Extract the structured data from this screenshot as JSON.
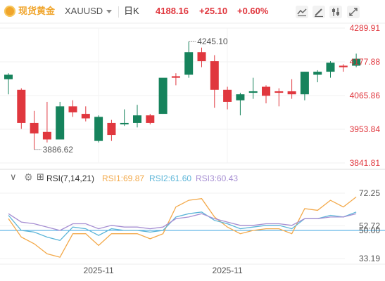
{
  "header": {
    "symbol_name": "现货黄金",
    "symbol_code": "XAUUSD",
    "period": "日K",
    "last_price": "4188.16",
    "change": "+25.10",
    "change_pct": "+0.60%"
  },
  "toolbar": {
    "icons": [
      "line-chart-icon",
      "draw-pen-icon",
      "settings-sliders-icon",
      "fullscreen-icon"
    ]
  },
  "chart_data": [
    {
      "type": "candlestick",
      "title": "",
      "y_ticks": [
        "4289.91",
        "4177.88",
        "4065.86",
        "3953.84",
        "3841.81"
      ],
      "ylim": [
        3841.81,
        4289.91
      ],
      "x_ticks": [
        {
          "label": "2025-11",
          "index": 7
        },
        {
          "label": "2025-11",
          "index": 17
        }
      ],
      "annotations": [
        {
          "text": "4245.10",
          "index": 14,
          "value": 4245.1
        },
        {
          "text": "3886.62",
          "index": 2,
          "value": 3886.62
        }
      ],
      "colors": {
        "up": "#e0373e",
        "down": "#16835c"
      },
      "candles": [
        {
          "o": 4120,
          "h": 4140,
          "l": 4070,
          "c": 4135
        },
        {
          "o": 4085,
          "h": 4090,
          "l": 3955,
          "c": 3975
        },
        {
          "o": 3975,
          "h": 4015,
          "l": 3886.62,
          "c": 3940
        },
        {
          "o": 3945,
          "h": 4045,
          "l": 3910,
          "c": 3920
        },
        {
          "o": 3920,
          "h": 4045,
          "l": 3920,
          "c": 4030
        },
        {
          "o": 4030,
          "h": 4050,
          "l": 3995,
          "c": 4010
        },
        {
          "o": 4005,
          "h": 4030,
          "l": 3980,
          "c": 3990
        },
        {
          "o": 3915,
          "h": 4000,
          "l": 3910,
          "c": 3995
        },
        {
          "o": 3975,
          "h": 3985,
          "l": 3915,
          "c": 3935
        },
        {
          "o": 3970,
          "h": 4020,
          "l": 3965,
          "c": 3975
        },
        {
          "o": 3975,
          "h": 4035,
          "l": 3960,
          "c": 4000
        },
        {
          "o": 4000,
          "h": 4005,
          "l": 3970,
          "c": 3975
        },
        {
          "o": 4005,
          "h": 4120,
          "l": 4005,
          "c": 4125
        },
        {
          "o": 4130,
          "h": 4140,
          "l": 4100,
          "c": 4125
        },
        {
          "o": 4135,
          "h": 4245.1,
          "l": 4125,
          "c": 4210
        },
        {
          "o": 4210,
          "h": 4225,
          "l": 4160,
          "c": 4180
        },
        {
          "o": 4180,
          "h": 4200,
          "l": 4025,
          "c": 4085
        },
        {
          "o": 4085,
          "h": 4095,
          "l": 4020,
          "c": 4045
        },
        {
          "o": 4050,
          "h": 4075,
          "l": 4000,
          "c": 4070
        },
        {
          "o": 4075,
          "h": 4125,
          "l": 4055,
          "c": 4080
        },
        {
          "o": 4095,
          "h": 4100,
          "l": 4040,
          "c": 4065
        },
        {
          "o": 4080,
          "h": 4090,
          "l": 4030,
          "c": 4075
        },
        {
          "o": 4080,
          "h": 4120,
          "l": 4055,
          "c": 4070
        },
        {
          "o": 4070,
          "h": 4145,
          "l": 4050,
          "c": 4145
        },
        {
          "o": 4135,
          "h": 4150,
          "l": 4110,
          "c": 4145
        },
        {
          "o": 4145,
          "h": 4180,
          "l": 4125,
          "c": 4175
        },
        {
          "o": 4165,
          "h": 4170,
          "l": 4145,
          "c": 4160
        },
        {
          "o": 4165,
          "h": 4205,
          "l": 4160,
          "c": 4188.16
        }
      ]
    },
    {
      "type": "line",
      "title": "",
      "indicator_label": "RSI(7,14,21)",
      "ylim": [
        33.19,
        72.25
      ],
      "y_ticks": [
        "72.25",
        "52.72",
        "50.00",
        "33.19"
      ],
      "reference_line": 50,
      "x_ticks": [
        {
          "label": "2025-11",
          "index": 7
        },
        {
          "label": "2025-11",
          "index": 17
        }
      ],
      "series": [
        {
          "name": "RSI1:69.87",
          "color": "#f3a94a",
          "values": [
            57,
            46,
            42,
            36,
            34,
            48,
            48,
            41,
            48,
            48,
            48,
            45,
            48,
            64,
            68,
            69,
            58,
            52,
            48,
            50,
            51,
            51,
            48,
            63,
            62,
            68,
            64,
            70
          ]
        },
        {
          "name": "RSI2:61.60",
          "color": "#5cb5d8",
          "values": [
            59,
            50,
            49,
            46,
            44,
            52,
            51,
            47,
            51,
            50,
            50,
            49,
            50,
            58,
            60,
            61,
            56,
            54,
            51,
            52,
            53,
            53,
            51,
            57,
            57,
            59,
            58,
            61
          ]
        },
        {
          "name": "RSI3:60.43",
          "color": "#a68ed2",
          "values": [
            60,
            55,
            54,
            52,
            50,
            54,
            54,
            51,
            53,
            52,
            52,
            51,
            52,
            57,
            58,
            60,
            57,
            55,
            53,
            53,
            54,
            54,
            53,
            57,
            57,
            58,
            58,
            60
          ]
        }
      ]
    }
  ]
}
